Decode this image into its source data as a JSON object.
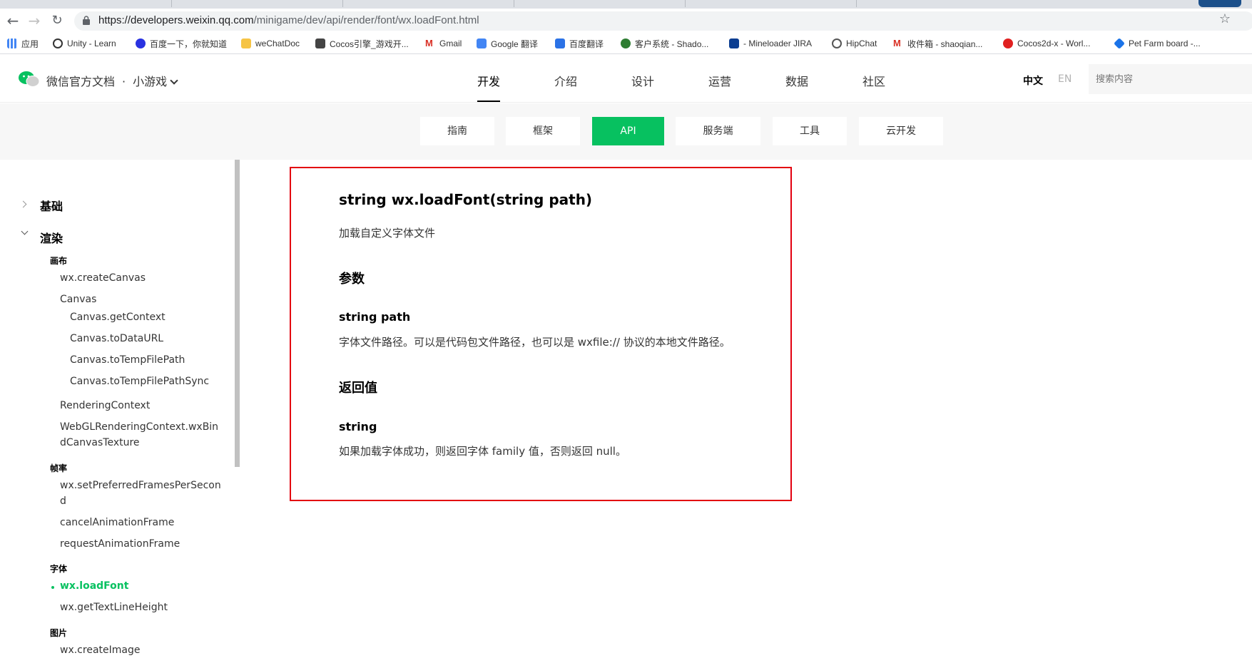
{
  "browser": {
    "url_host": "https://developers.weixin.qq.com",
    "url_path": "/minigame/dev/api/render/font/wx.loadFont.html"
  },
  "bookmarks": [
    {
      "label": "应用",
      "color": "#4285f4"
    },
    {
      "label": "Unity - Learn",
      "color": "#333333"
    },
    {
      "label": "百度一下，你就知道",
      "color": "#2932e1"
    },
    {
      "label": "weChatDoc",
      "color": "#f6c445"
    },
    {
      "label": "Cocos引擎_游戏开...",
      "color": "#444444"
    },
    {
      "label": "Gmail",
      "color": "#d93025"
    },
    {
      "label": "Google 翻译",
      "color": "#4285f4"
    },
    {
      "label": "百度翻译",
      "color": "#2b72e6"
    },
    {
      "label": "客户系统 - Shado...",
      "color": "#2e7d32"
    },
    {
      "label": "- Mineloader JIRA",
      "color": "#0b3d91"
    },
    {
      "label": "HipChat",
      "color": "#555555"
    },
    {
      "label": "收件箱 - shaoqian...",
      "color": "#d93025"
    },
    {
      "label": "Cocos2d-x - Worl...",
      "color": "#e02020"
    },
    {
      "label": "Pet Farm board -...",
      "color": "#1a73e8"
    }
  ],
  "header": {
    "brand": "微信官方文档",
    "dot": "·",
    "product": "小游戏",
    "nav": [
      "开发",
      "介绍",
      "设计",
      "运营",
      "数据",
      "社区"
    ],
    "lang_zh": "中文",
    "lang_en": "EN",
    "search_placeholder": "搜索内容"
  },
  "subnav": [
    "指南",
    "框架",
    "API",
    "服务端",
    "工具",
    "云开发"
  ],
  "sidebar": {
    "sections": [
      "基础",
      "渲染"
    ],
    "groups": [
      "画布",
      "帧率",
      "字体",
      "图片"
    ],
    "items": [
      "wx.createCanvas",
      "Canvas",
      "Canvas.getContext",
      "Canvas.toDataURL",
      "Canvas.toTempFilePath",
      "Canvas.toTempFilePathSync",
      "RenderingContext",
      "WebGLRenderingContext.wxBin",
      "dCanvasTexture",
      "wx.setPreferredFramesPerSecon",
      "d",
      "cancelAnimationFrame",
      "requestAnimationFrame",
      "wx.loadFont",
      "wx.getTextLineHeight",
      "wx.createImage"
    ]
  },
  "content": {
    "title": "string wx.loadFont(string path)",
    "description": "加载自定义字体文件",
    "params_heading": "参数",
    "param_name": "string path",
    "param_desc": "字体文件路径。可以是代码包文件路径，也可以是 wxfile:// 协议的本地文件路径。",
    "return_heading": "返回值",
    "return_type": "string",
    "return_desc": "如果加载字体成功，则返回字体 family 值，否则返回 null。"
  },
  "colors": {
    "accent": "#07c160",
    "highlight_box": "#e3000f"
  }
}
